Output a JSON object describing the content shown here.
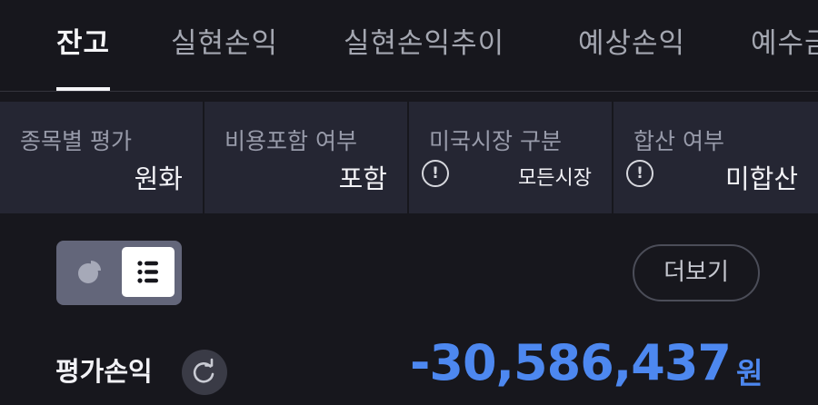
{
  "tabs": [
    {
      "label": "잔고",
      "active": true
    },
    {
      "label": "실현손익",
      "active": false
    },
    {
      "label": "실현손익추이",
      "active": false
    },
    {
      "label": "예상손익",
      "active": false
    },
    {
      "label": "예수금",
      "active": false
    }
  ],
  "filters": [
    {
      "label": "종목별 평가",
      "value": "원화"
    },
    {
      "label": "비용포함 여부",
      "value": "포함"
    },
    {
      "label": "미국시장 구분",
      "value": "모든시장",
      "icon": "info-icon"
    },
    {
      "label": "합산 여부",
      "value": "미합산",
      "icon": "info-icon"
    }
  ],
  "view_toggle": {
    "options": [
      "pie-chart-icon",
      "list-icon"
    ],
    "selected": "list-icon"
  },
  "more_button": "더보기",
  "pnl": {
    "label": "평가손익",
    "value": "-30,586,437",
    "unit": "원",
    "refresh_icon": "refresh-icon"
  },
  "colors": {
    "background": "#17171d",
    "panel": "#252633",
    "negative": "#4d88f0",
    "toggle_bg": "#63667a"
  }
}
